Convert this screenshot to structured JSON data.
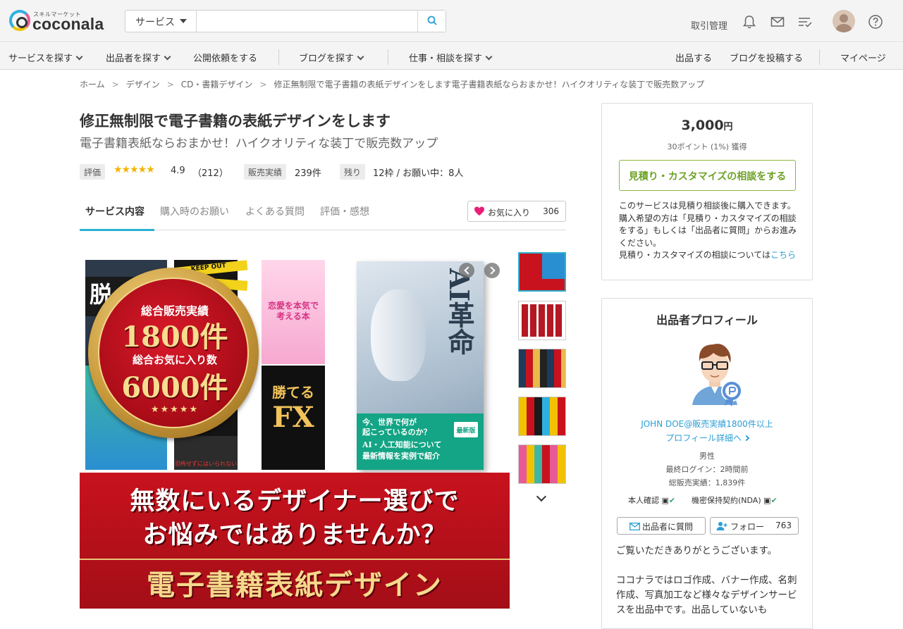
{
  "header": {
    "logo_sub": "スキルマーケット",
    "logo_text": "coconala",
    "search_category": "サービス",
    "search_placeholder": "",
    "transactions_label": "取引管理"
  },
  "nav": {
    "items": [
      "サービスを探す",
      "出品者を探す",
      "公開依頼をする",
      "ブログを探す",
      "仕事・相談を探す"
    ],
    "right_items": [
      "出品する",
      "ブログを投稿する",
      "マイページ"
    ]
  },
  "breadcrumbs": [
    "ホーム",
    "デザイン",
    "CD・書籍デザイン",
    "修正無制限で電子書籍の表紙デザインをします電子書籍表紙ならおまかせ！ハイクオリティな装丁で販売数アップ"
  ],
  "service": {
    "title": "修正無制限で電子書籍の表紙デザインをします",
    "subtitle": "電子書籍表紙ならおまかせ！ハイクオリティな装丁で販売数アップ",
    "rating_label": "評価",
    "stars": "★★★★★",
    "rating_value": "4.9",
    "rating_count": "（212）",
    "sales_label": "販売実績",
    "sales_value": "239件",
    "remaining_label": "残り",
    "remaining_value": "12枠 / お願い中：8人"
  },
  "tabs": [
    "サービス内容",
    "購入時のお願い",
    "よくある質問",
    "評価・感想"
  ],
  "favorite": {
    "label": "お気に入り",
    "count": "306"
  },
  "hero": {
    "medal_line1": "総合販売実績",
    "medal_line2": "1800件",
    "medal_line3": "総合お気に入り数",
    "medal_line4": "6000件",
    "medal_stars": "★★★★★",
    "banner_line1": "無数にいるデザイナー選びで",
    "banner_line2": "お悩みではありませんか？",
    "banner_line3": "電子書籍表紙デザイン",
    "cover_ai_title": "AI革命",
    "cover_ai_text1": "今、世界で何が",
    "cover_ai_text2": "起こっているのか？",
    "cover_ai_text3": "AI・人工知能について",
    "cover_ai_text4": "最新情報を実例で紹介",
    "cover_ai_badge": "最新版",
    "cover_love": "恋愛を本気で考える本",
    "cover_fx_top": "勝てる",
    "cover_fx_big": "FX",
    "cover_left_title": "脱",
    "cover_keepout": "KEEP OUT",
    "cover_horror": "恐怖せずにはいられない"
  },
  "purchase": {
    "price": "3,000",
    "price_unit": "円",
    "points": "30ポイント (1%) 獲得",
    "consult_button": "見積り・カスタマイズの相談をする",
    "note": "このサービスは見積り相談後に購入できます。購入希望の方は「見積り・カスタマイズの相談をする」もしくは「出品者に質問」からお進みください。",
    "note_link_prefix": "見積り・カスタマイズの相談については",
    "note_link": "こちら"
  },
  "profile": {
    "title": "出品者プロフィール",
    "name": "JOHN DOE@販売実績1800件以上",
    "detail_link": "プロフィール詳細へ",
    "gender": "男性",
    "last_login": "最終ログイン：2時間前",
    "total_sales": "総販売実績：1,839件",
    "id_verify": "本人確認",
    "nda": "機密保持契約(NDA)",
    "question_button": "出品者に質問",
    "follow_button": "フォロー",
    "follow_count": "763",
    "description": "ご覧いただきありがとうございます。\n\nココナラではロゴ作成、バナー作成、名刺作成、写真加工など様々なデザインサービスを出品中です。出品していないも"
  },
  "colors": {
    "accent_blue": "#2bb0d0",
    "link_blue": "#2b9ed6",
    "consult_green": "#6ea227",
    "banner_red": "#c8121e",
    "favorite_pink": "#e91e78"
  }
}
